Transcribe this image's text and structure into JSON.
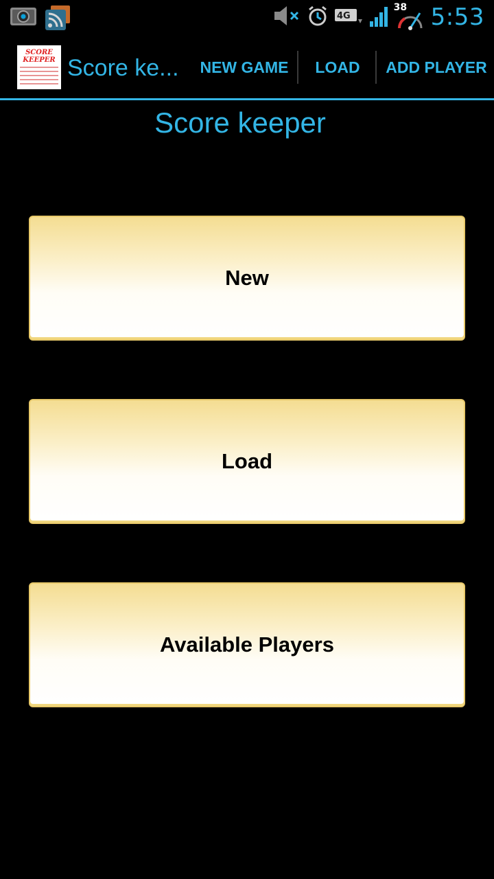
{
  "status_bar": {
    "time": "5:53",
    "temperature": "38",
    "network_label": "4G",
    "icons": [
      "camera-icon",
      "rss-icon",
      "muted-speaker-icon",
      "alarm-clock-icon",
      "4g-lte-icon",
      "signal-bars-icon",
      "speedometer-icon"
    ]
  },
  "action_bar": {
    "title": "Score ke...",
    "app_icon_text": "SCORE KEEPER",
    "actions": {
      "new_game": "NEW GAME",
      "load": "LOAD",
      "add_player": "ADD PLAYER"
    },
    "accent_color": "#33b5e5"
  },
  "main": {
    "heading": "Score keeper",
    "buttons": {
      "new": "New",
      "load": "Load",
      "available_players": "Available Players"
    }
  }
}
